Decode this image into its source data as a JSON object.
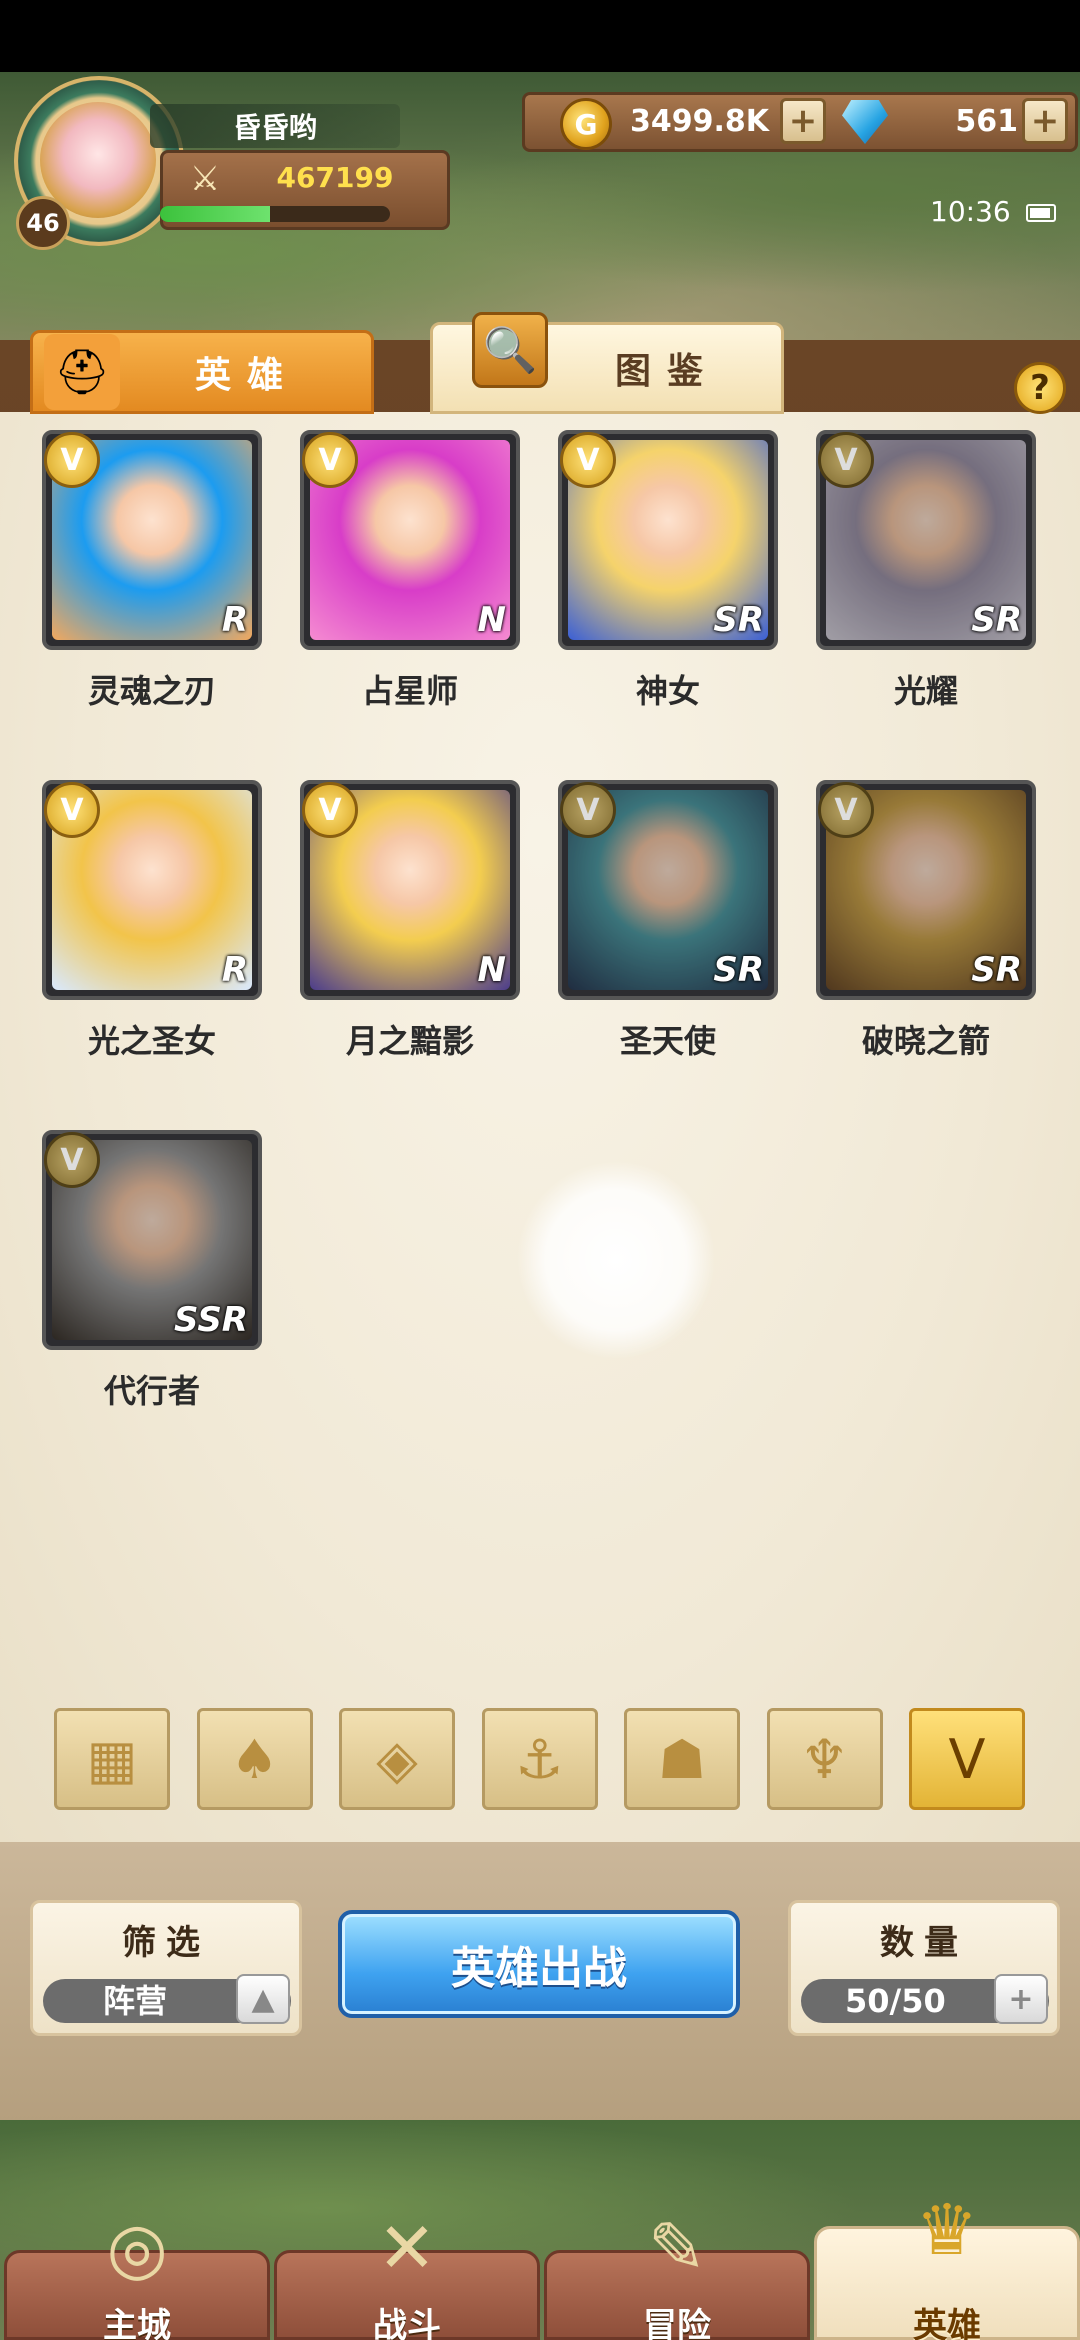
{
  "player": {
    "name": "昏昏哟",
    "level": "46",
    "power": "467199",
    "xp_progress": 0.48
  },
  "currency": {
    "gold": "3499.8K",
    "gold_icon": "G",
    "gems": "561",
    "plus": "+"
  },
  "status": {
    "time": "10:36"
  },
  "tabs": {
    "heroes": "英雄",
    "codex": "图鉴"
  },
  "help": "?",
  "heroes": [
    {
      "name": "灵魂之刃",
      "rarity": "R",
      "owned": true,
      "colors": [
        "#1c9cf0",
        "#f3a85d"
      ]
    },
    {
      "name": "占星师",
      "rarity": "N",
      "owned": true,
      "colors": [
        "#d83dc8",
        "#f58bd1"
      ]
    },
    {
      "name": "神女",
      "rarity": "SR",
      "owned": true,
      "colors": [
        "#f5d36b",
        "#3a5fd6"
      ]
    },
    {
      "name": "光耀",
      "rarity": "SR",
      "owned": false,
      "colors": [
        "#9c93a8",
        "#d6d2dc"
      ]
    },
    {
      "name": "光之圣女",
      "rarity": "R",
      "owned": true,
      "colors": [
        "#f2c44a",
        "#d9e9ff"
      ]
    },
    {
      "name": "月之黯影",
      "rarity": "N",
      "owned": true,
      "colors": [
        "#f3cd4f",
        "#4b3c8c"
      ]
    },
    {
      "name": "圣天使",
      "rarity": "SR",
      "owned": false,
      "colors": [
        "#4e9aa3",
        "#2a3b55"
      ]
    },
    {
      "name": "破晓之箭",
      "rarity": "SR",
      "owned": false,
      "colors": [
        "#caa24a",
        "#6b4a28"
      ]
    },
    {
      "name": "代行者",
      "rarity": "SSR",
      "owned": false,
      "colors": [
        "#9b9b9b",
        "#3a332c"
      ]
    }
  ],
  "badge_glyph": "V",
  "factions": [
    {
      "icon": "grid-icon",
      "glyph": "▦",
      "active": false
    },
    {
      "icon": "leaf-icon",
      "glyph": "♠",
      "active": false
    },
    {
      "icon": "diamond-icon",
      "glyph": "◈",
      "active": false
    },
    {
      "icon": "anchor-icon",
      "glyph": "⚓",
      "active": false
    },
    {
      "icon": "beast-icon",
      "glyph": "☗",
      "active": false
    },
    {
      "icon": "horns-icon",
      "glyph": "♆",
      "active": false
    },
    {
      "icon": "chevron-icon",
      "glyph": "V",
      "active": true
    }
  ],
  "bottom": {
    "filter_title": "筛选",
    "filter_value": "阵营",
    "deploy": "英雄出战",
    "count_title": "数量",
    "count_value": "50/50",
    "expand": "▲",
    "plus": "+"
  },
  "nav": [
    {
      "label": "主城",
      "icon": "castle-icon",
      "glyph": "◎",
      "active": false
    },
    {
      "label": "战斗",
      "icon": "swords-icon",
      "glyph": "✕",
      "active": false
    },
    {
      "label": "冒险",
      "icon": "scroll-icon",
      "glyph": "✎",
      "active": false
    },
    {
      "label": "英雄",
      "icon": "helmet-icon",
      "glyph": "♛",
      "active": true
    }
  ]
}
